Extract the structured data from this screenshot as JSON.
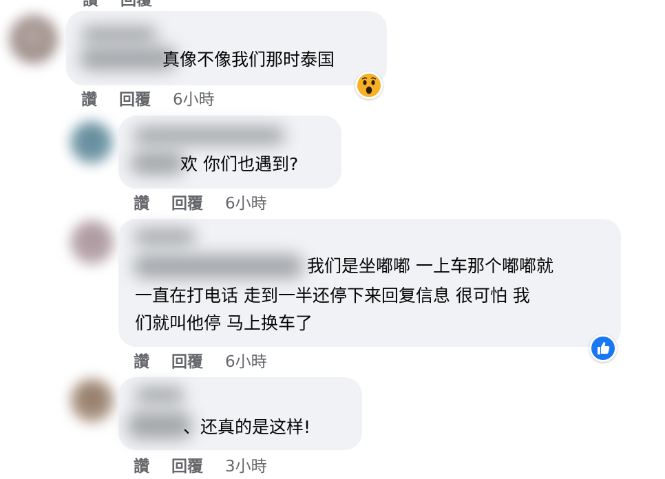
{
  "actions": {
    "like": "讚",
    "reply": "回覆"
  },
  "comments": [
    {
      "text": "真像不像我们那时泰国",
      "time": "6小時",
      "reaction": "wow"
    },
    {
      "text": "欢 你们也遇到?",
      "time": "6小時"
    },
    {
      "lines": [
        "我们是坐嘟嘟 一上车那个嘟嘟就",
        "一直在打电话 走到一半还停下来回复信息 很可怕 我",
        "们就叫他停 马上换车了"
      ],
      "time": "6小時",
      "reaction": "like"
    },
    {
      "text": "、还真的是这样!",
      "time": "3小時"
    }
  ],
  "colors": {
    "bubble": "#f0f2f5",
    "secondary_text": "#65676b",
    "like_blue": "#1877f2",
    "wow_yellow": "#f7b125"
  }
}
